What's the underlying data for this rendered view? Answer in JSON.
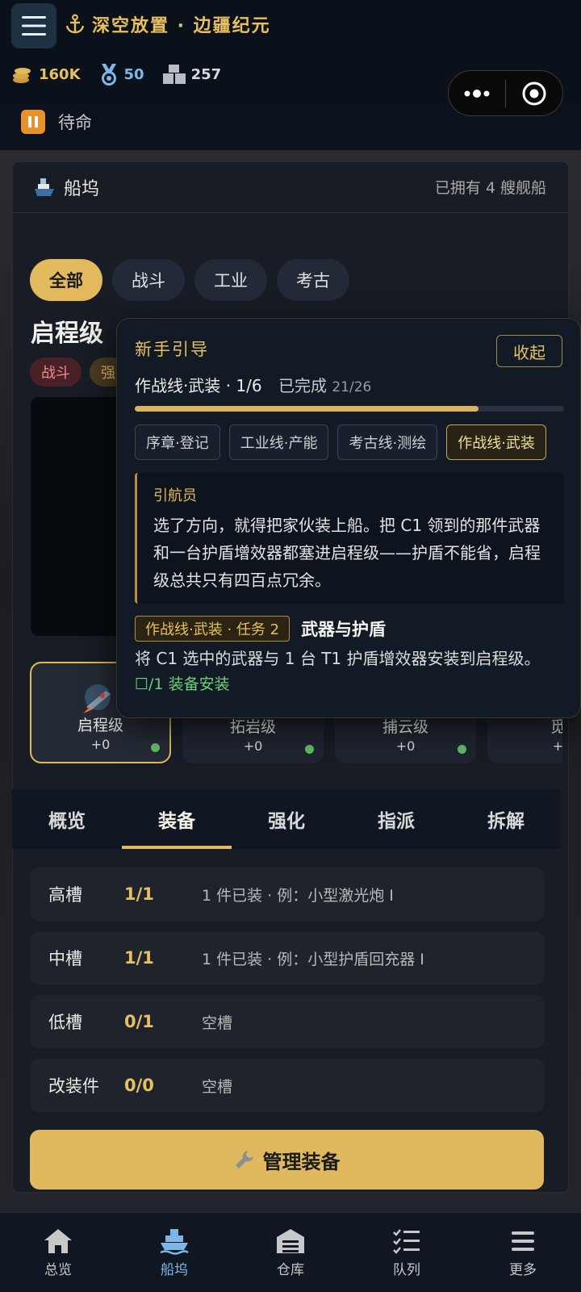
{
  "header": {
    "title": "深空放置 · 边疆纪元",
    "resources": [
      {
        "icon": "coin-stack-icon",
        "value": "160K"
      },
      {
        "icon": "medal-icon",
        "value": "50"
      },
      {
        "icon": "crates-icon",
        "value": "257"
      }
    ],
    "status": "待命"
  },
  "dock": {
    "title": "船坞",
    "owned": "已拥有 4 艘舰船",
    "filters": [
      "全部",
      "战斗",
      "工业",
      "考古"
    ],
    "selected_ship": "启程级",
    "tags": [
      "战斗",
      "强"
    ],
    "ships": [
      {
        "name": "启程级",
        "power": "+0"
      },
      {
        "name": "拓岩级",
        "power": "+0"
      },
      {
        "name": "捕云级",
        "power": "+0"
      },
      {
        "name": "觅",
        "power": "+"
      }
    ],
    "tabs": [
      "概览",
      "装备",
      "强化",
      "指派",
      "拆解"
    ],
    "slots": [
      {
        "name": "高槽",
        "count": "1/1",
        "desc": "1 件已装 · 例：小型激光炮 I"
      },
      {
        "name": "中槽",
        "count": "1/1",
        "desc": "1 件已装 · 例：小型护盾回充器 I"
      },
      {
        "name": "低槽",
        "count": "0/1",
        "desc": "空槽"
      },
      {
        "name": "改装件",
        "count": "0/0",
        "desc": "空槽"
      }
    ],
    "manage_button": "管理装备"
  },
  "guide": {
    "title": "新手引导",
    "fold_button": "收起",
    "progress_label": "作战线·武装 · 1/6",
    "completed_label": "已完成",
    "completed_count": "21/26",
    "progress_fraction": 0.8,
    "lines": [
      "序章·登记",
      "工业线·产能",
      "考古线·测绘",
      "作战线·武装"
    ],
    "speaker": "引航员",
    "quote": "选了方向，就得把家伙装上船。把 C1 领到的那件武器和一台护盾增效器都塞进启程级——护盾不能省，启程级总共只有四百点冗余。",
    "task_badge": "作战线·武装 · 任务 2",
    "task_name": "武器与护盾",
    "task_desc": "将 C1 选中的武器与 1 台 T1 护盾增效器安装到启程级。",
    "task_check": "☐/1 装备安装"
  },
  "bottom_nav": [
    "总览",
    "船坞",
    "仓库",
    "队列",
    "更多"
  ],
  "colors": {
    "accent": "#e2b95c",
    "active_nav": "#7fb6e8",
    "success": "#6fd07a"
  }
}
